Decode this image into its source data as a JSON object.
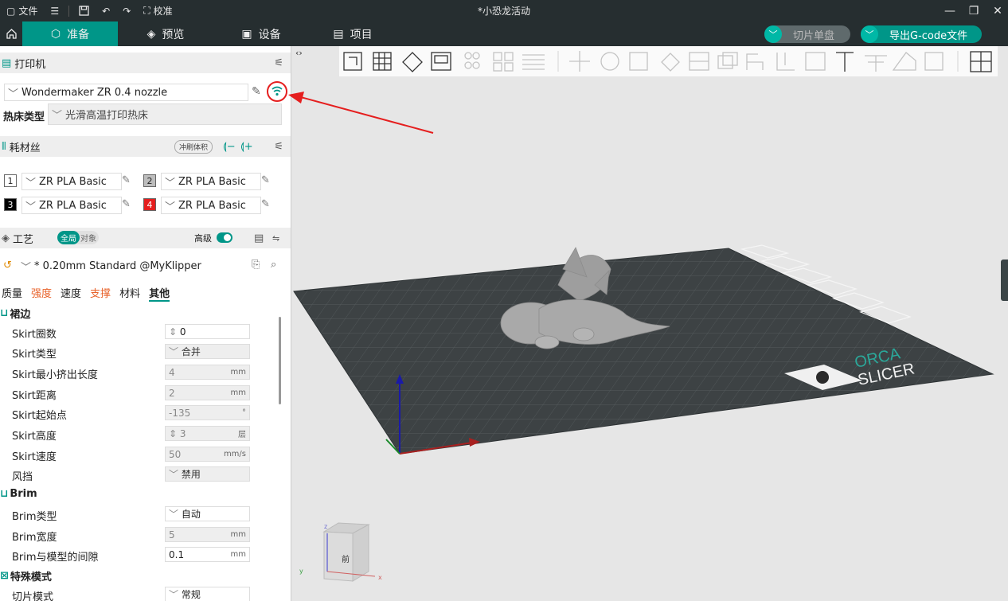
{
  "titlebar": {
    "file_label": "文件",
    "calibrate_label": "校准",
    "window_title": "*小恐龙活动"
  },
  "tabs": {
    "prepare": "准备",
    "preview": "预览",
    "device": "设备",
    "project": "项目"
  },
  "actions": {
    "slice_plate": "切片单盘",
    "export_gcode": "导出G-code文件"
  },
  "printer": {
    "section_title": "打印机",
    "selected": "Wondermaker ZR 0.4 nozzle",
    "bed_type_label": "热床类型",
    "bed_type_value": "光滑高温打印热床"
  },
  "filament": {
    "section_title": "耗材丝",
    "flush_button": "冲刷体积",
    "slots": [
      {
        "num": "1",
        "name": "ZR PLA Basic",
        "color": "#ffffff",
        "text_color": "#222222"
      },
      {
        "num": "2",
        "name": "ZR PLA Basic",
        "color": "#bdbdbd",
        "text_color": "#222222"
      },
      {
        "num": "3",
        "name": "ZR PLA Basic",
        "color": "#000000",
        "text_color": "#ffffff"
      },
      {
        "num": "4",
        "name": "ZR PLA Basic",
        "color": "#e51e1e",
        "text_color": "#ffffff"
      }
    ]
  },
  "process": {
    "section_title": "工艺",
    "toggle_global": "全局",
    "toggle_object": "对象",
    "advanced_label": "高级",
    "preset": "* 0.20mm Standard @MyKlipper",
    "tabs": [
      "质量",
      "强度",
      "速度",
      "支撑",
      "材料",
      "其他"
    ],
    "active_tab": "其他"
  },
  "settings": {
    "skirt_group": "裙边",
    "skirt_loops_label": "Skirt圈数",
    "skirt_loops_value": "0",
    "skirt_type_label": "Skirt类型",
    "skirt_type_value": "合并",
    "skirt_min_extrude_label": "Skirt最小挤出长度",
    "skirt_min_extrude_value": "4",
    "skirt_min_extrude_unit": "mm",
    "skirt_distance_label": "Skirt距离",
    "skirt_distance_value": "2",
    "skirt_distance_unit": "mm",
    "skirt_start_label": "Skirt起始点",
    "skirt_start_value": "-135",
    "skirt_start_unit": "°",
    "skirt_height_label": "Skirt高度",
    "skirt_height_value": "3",
    "skirt_height_unit": "层",
    "skirt_speed_label": "Skirt速度",
    "skirt_speed_value": "50",
    "skirt_speed_unit": "mm/s",
    "draft_shield_label": "风挡",
    "draft_shield_value": "禁用",
    "brim_group": "Brim",
    "brim_type_label": "Brim类型",
    "brim_type_value": "自动",
    "brim_width_label": "Brim宽度",
    "brim_width_value": "5",
    "brim_width_unit": "mm",
    "brim_gap_label": "Brim与模型的间隙",
    "brim_gap_value": "0.1",
    "brim_gap_unit": "mm",
    "special_group": "特殊模式",
    "slice_mode_label": "切片模式",
    "slice_mode_value": "常规"
  },
  "viewport": {
    "plate_logo_top": "ORCA",
    "plate_logo_bottom": "SLICER",
    "cube_front": "前",
    "axis_x": "x",
    "axis_y": "y",
    "axis_z": "z"
  },
  "colors": {
    "accent": "#009688",
    "titlebar": "#262e30",
    "plate": "#3d4244",
    "highlight": "#e51e1e"
  }
}
